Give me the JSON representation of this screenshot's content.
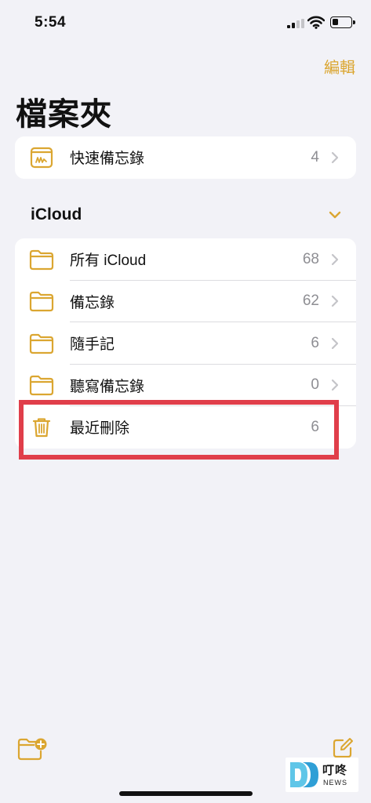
{
  "status_bar": {
    "time": "5:54"
  },
  "nav": {
    "edit_label": "編輯",
    "title": "檔案夾"
  },
  "quick_notes": {
    "label": "快速備忘錄",
    "count": "4"
  },
  "icloud_section": {
    "header": "iCloud",
    "folders": [
      {
        "label": "所有 iCloud",
        "count": "68",
        "icon": "folder-icon"
      },
      {
        "label": "備忘錄",
        "count": "62",
        "icon": "folder-icon"
      },
      {
        "label": "隨手記",
        "count": "6",
        "icon": "folder-icon"
      },
      {
        "label": "聽寫備忘錄",
        "count": "0",
        "icon": "folder-icon"
      },
      {
        "label": "最近刪除",
        "count": "6",
        "icon": "trash-icon"
      }
    ]
  },
  "watermark": {
    "name": "叮咚",
    "sub": "NEWS"
  },
  "colors": {
    "accent": "#dba631",
    "highlight": "#e03e4a",
    "background": "#f2f2f7"
  }
}
